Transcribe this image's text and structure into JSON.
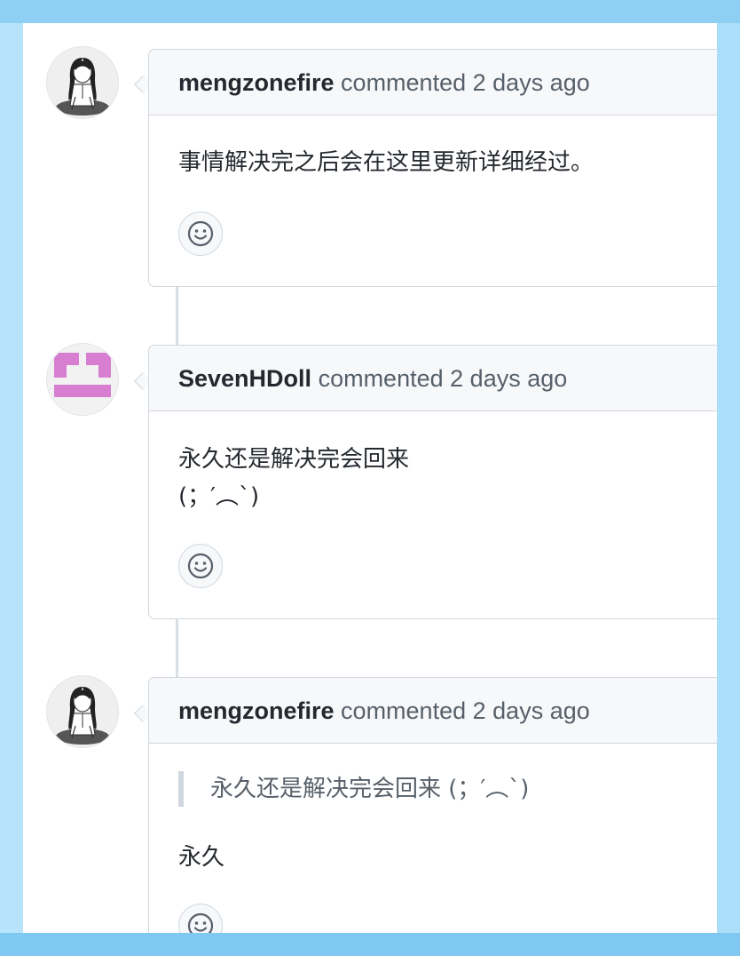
{
  "comments": [
    {
      "author": "mengzonefire",
      "action": "commented",
      "time": "2 days ago",
      "avatar": "anime-girl-sketch-avatar",
      "lines": [
        "事情解决完之后会在这里更新详细经过。"
      ]
    },
    {
      "author": "SevenHDoll",
      "action": "commented",
      "time": "2 days ago",
      "avatar": "pink-identicon-avatar",
      "lines": [
        "永久还是解决完会回来",
        "(；′︵`)"
      ]
    },
    {
      "author": "mengzonefire",
      "action": "commented",
      "time": "2 days ago",
      "avatar": "anime-girl-sketch-avatar",
      "quote": "永久还是解决完会回来 (；′︵`)",
      "lines": [
        "永久"
      ]
    }
  ],
  "reaction_icon": "smiley-icon",
  "colors": {
    "frame_blue": "#8ecff3",
    "header_bg": "#f6f8fa",
    "border": "#d0d7de",
    "identicon_pink": "#d77ed0"
  }
}
